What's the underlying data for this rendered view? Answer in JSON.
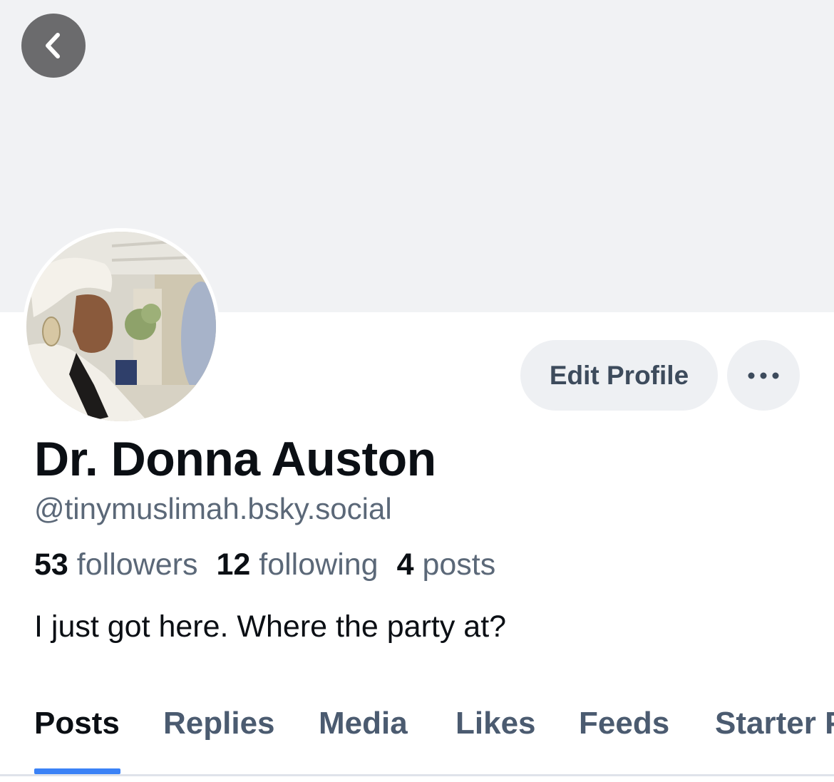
{
  "header": {
    "back_icon": "chevron-left-icon",
    "banner_color": "#f1f2f4"
  },
  "profile": {
    "display_name": "Dr. Donna Auston",
    "handle": "@tinymuslimah.bsky.social",
    "bio": "I just got here. Where the party at?",
    "stats": {
      "followers_count": "53",
      "followers_label": "followers",
      "following_count": "12",
      "following_label": "following",
      "posts_count": "4",
      "posts_label": "posts"
    }
  },
  "actions": {
    "edit_profile_label": "Edit Profile",
    "more_icon": "more-horizontal-icon"
  },
  "tabs": [
    {
      "label": "Posts",
      "active": true
    },
    {
      "label": "Replies",
      "active": false
    },
    {
      "label": "Media",
      "active": false
    },
    {
      "label": "Likes",
      "active": false
    },
    {
      "label": "Feeds",
      "active": false
    },
    {
      "label": "Starter Packs",
      "active": false
    }
  ],
  "colors": {
    "accent": "#3b82f6",
    "text_primary": "#0b0f14",
    "text_secondary": "#5b6878"
  }
}
